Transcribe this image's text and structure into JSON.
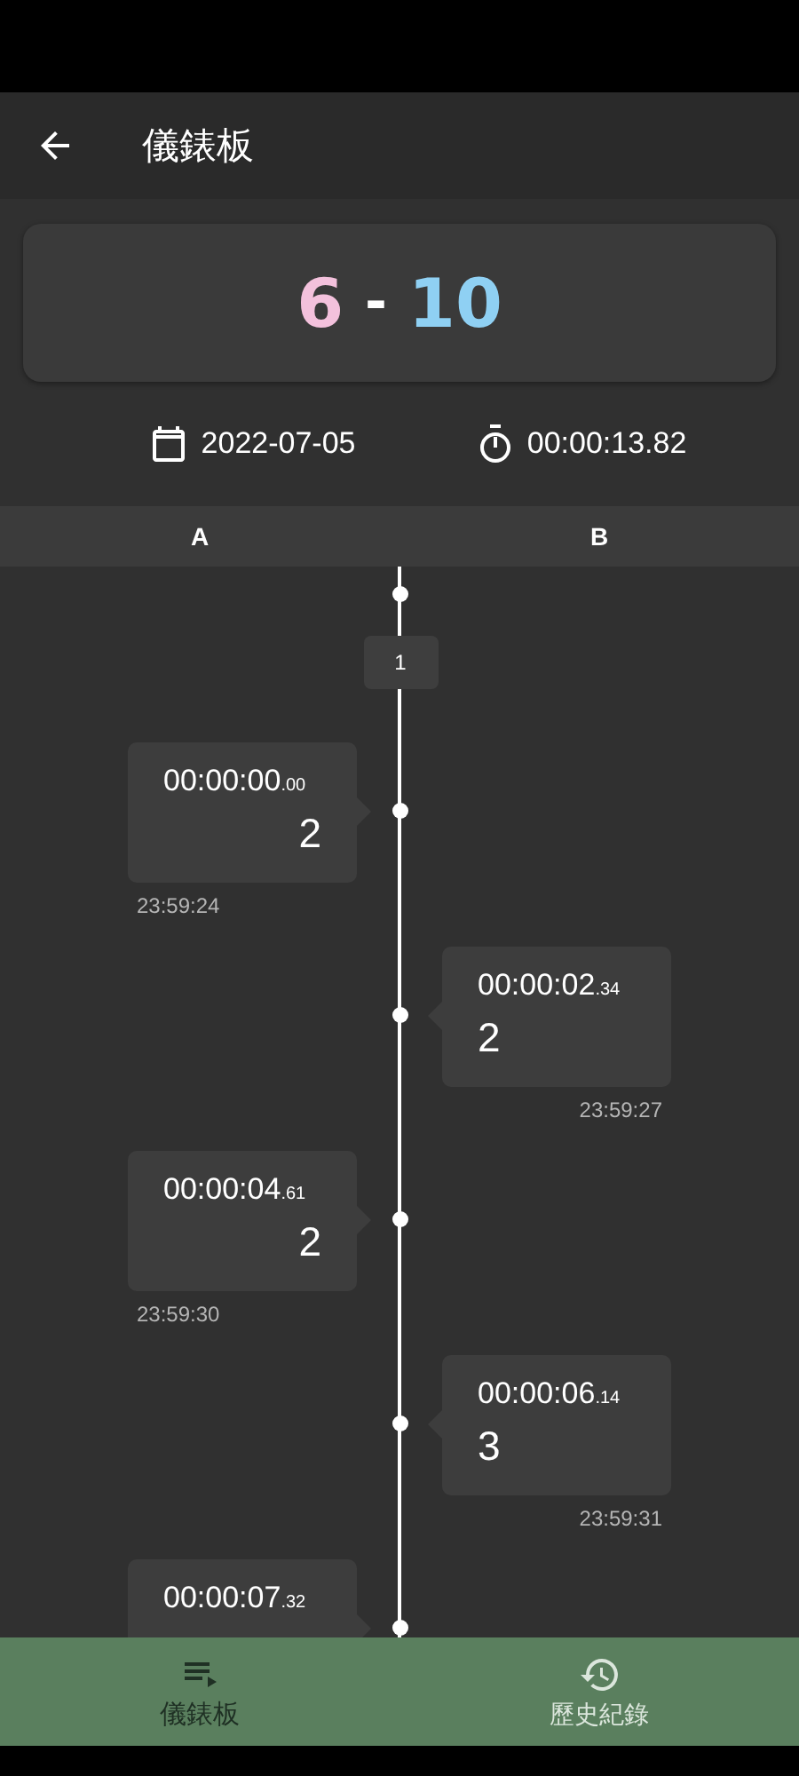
{
  "app_bar": {
    "title": "儀錶板"
  },
  "score": {
    "team_a": "6",
    "separator": "-",
    "team_b": "10"
  },
  "info": {
    "date": "2022-07-05",
    "duration": "00:00:13.82"
  },
  "columns": [
    "A",
    "B"
  ],
  "timeline": [
    {
      "kind": "start"
    },
    {
      "kind": "set",
      "label": "1"
    },
    {
      "kind": "event_a",
      "time": "00:00:00",
      "fraction": ".00",
      "value": "2",
      "clock": "23:59:24"
    },
    {
      "kind": "event_b",
      "time": "00:00:02",
      "fraction": ".34",
      "value": "2",
      "clock": "23:59:27"
    },
    {
      "kind": "event_a",
      "time": "00:00:04",
      "fraction": ".61",
      "value": "2",
      "clock": "23:59:30"
    },
    {
      "kind": "event_b",
      "time": "00:00:06",
      "fraction": ".14",
      "value": "3",
      "clock": "23:59:31"
    },
    {
      "kind": "event_a",
      "time": "00:00:07",
      "fraction": ".32"
    }
  ],
  "bottom_nav": [
    {
      "label": "儀錶板",
      "selected": true
    },
    {
      "label": "歷史紀錄",
      "selected": false
    }
  ]
}
